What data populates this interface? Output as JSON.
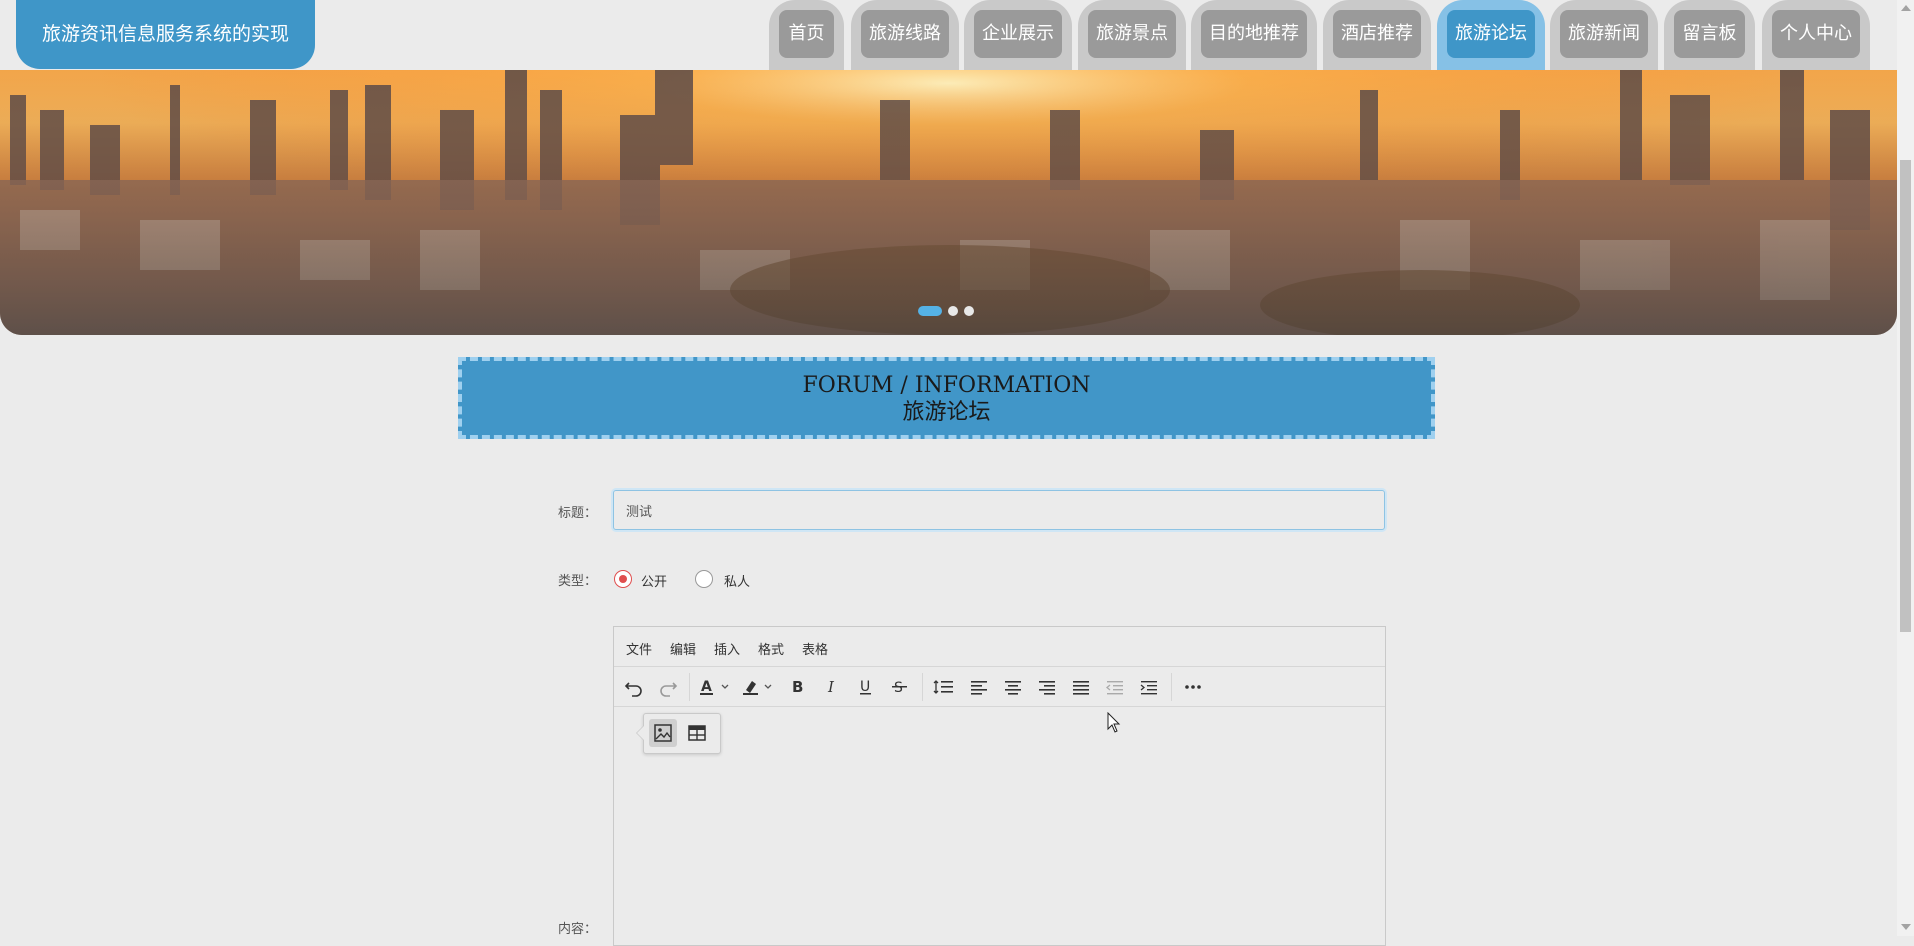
{
  "header": {
    "brand": "旅游资讯信息服务系统的实现",
    "nav": [
      {
        "label": "首页",
        "active": false
      },
      {
        "label": "旅游线路",
        "active": false
      },
      {
        "label": "企业展示",
        "active": false
      },
      {
        "label": "旅游景点",
        "active": false
      },
      {
        "label": "目的地推荐",
        "active": false
      },
      {
        "label": "酒店推荐",
        "active": false
      },
      {
        "label": "旅游论坛",
        "active": true
      },
      {
        "label": "旅游新闻",
        "active": false
      },
      {
        "label": "留言板",
        "active": false
      },
      {
        "label": "个人中心",
        "active": false
      }
    ]
  },
  "banner": {
    "slides": 3,
    "active_slide": 1
  },
  "section": {
    "title_en": "FORUM / INFORMATION",
    "title_zh": "旅游论坛"
  },
  "form": {
    "title_label": "标题：",
    "title_value": "测试",
    "type_label": "类型：",
    "type_options": [
      {
        "label": "公开",
        "checked": true
      },
      {
        "label": "私人",
        "checked": false
      }
    ],
    "content_label": "内容："
  },
  "editor": {
    "menu": [
      "文件",
      "编辑",
      "插入",
      "格式",
      "表格"
    ],
    "toolbar_icons": [
      "undo-icon",
      "redo-icon",
      "text-color-icon",
      "highlight-color-icon",
      "bold-icon",
      "italic-icon",
      "underline-icon",
      "strikethrough-icon",
      "line-height-icon",
      "align-left-icon",
      "align-center-icon",
      "align-right-icon",
      "align-justify-icon",
      "outdent-icon",
      "indent-icon",
      "more-icon"
    ],
    "popup_icons": [
      "image-icon",
      "table-icon"
    ]
  },
  "colors": {
    "accent": "#3f96c8",
    "nav_inactive": "#9a9a9a",
    "radio_checked": "#e04e4e"
  }
}
